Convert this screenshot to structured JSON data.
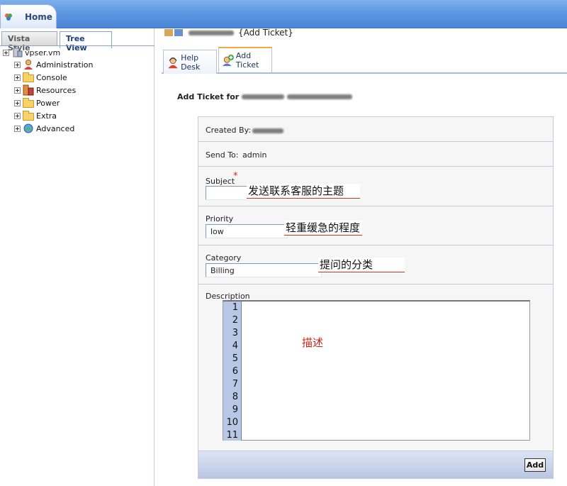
{
  "topbar": {
    "home_label": "Home"
  },
  "left_tabs": {
    "vista": "Vista Style",
    "tree": "Tree View"
  },
  "tree": {
    "root": "vpser.vm",
    "items": [
      {
        "label": "Administration",
        "icon": "admin-icon"
      },
      {
        "label": "Console",
        "icon": "folder-icon"
      },
      {
        "label": "Resources",
        "icon": "resources-icon"
      },
      {
        "label": "Power",
        "icon": "folder-icon"
      },
      {
        "label": "Extra",
        "icon": "folder-icon"
      },
      {
        "label": "Advanced",
        "icon": "advanced-icon"
      }
    ]
  },
  "header": {
    "title_suffix": "{Add Ticket}"
  },
  "tabs": [
    {
      "label": "Help Desk"
    },
    {
      "label": "Add Ticket"
    }
  ],
  "section_title": "Add Ticket for",
  "form": {
    "created_by_label": "Created By:",
    "send_to_label": "Send To:",
    "send_to_value": "admin",
    "subject_label": "Subject",
    "subject_required": "*",
    "subject_value": "",
    "subject_annotation": "发送联系客服的主题",
    "priority_label": "Priority",
    "priority_value": "low",
    "priority_annotation": "轻重缓急的程度",
    "category_label": "Category",
    "category_value": "Billing",
    "category_annotation": "提问的分类",
    "description_label": "Description",
    "description_annotation": "描述",
    "line_numbers": [
      "1",
      "2",
      "3",
      "4",
      "5",
      "6",
      "7",
      "8",
      "9",
      "10",
      "11"
    ],
    "add_button": "Add"
  },
  "colors": {
    "topbar": "#5d97e2",
    "gutter": "#b9c7e6",
    "annotation_underline": "#d9331f",
    "required": "#e2231a"
  }
}
